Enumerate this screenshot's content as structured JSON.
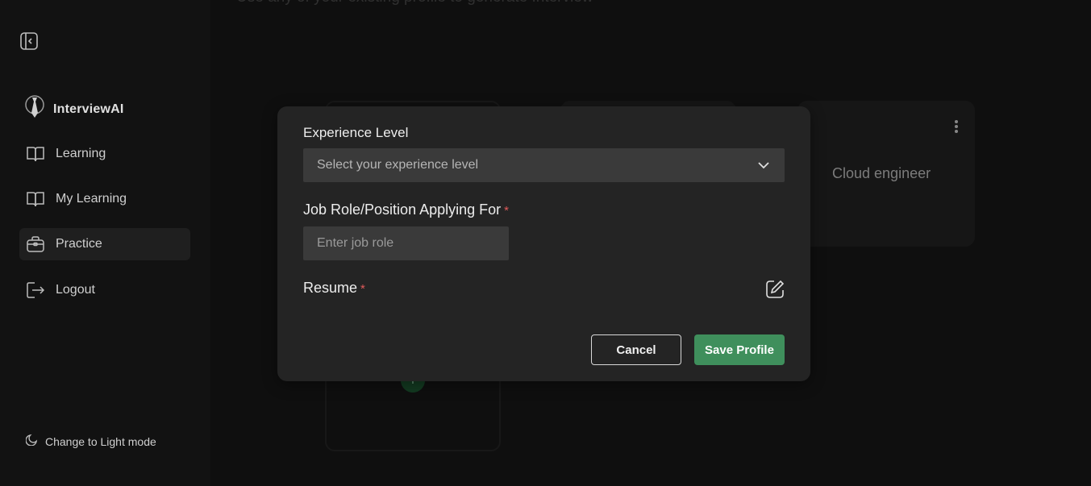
{
  "sidebar": {
    "brand": "InterviewAI",
    "items": [
      {
        "label": "Learning",
        "icon": "book-icon"
      },
      {
        "label": "My Learning",
        "icon": "book-icon"
      },
      {
        "label": "Practice",
        "icon": "briefcase-icon",
        "active": true
      },
      {
        "label": "Logout",
        "icon": "logout-icon"
      }
    ],
    "theme_toggle": "Change to Light mode"
  },
  "main": {
    "subtitle": "Use any of your existing profile to generate Interview",
    "profile_card_title": "Cloud engineer",
    "add_button": "+"
  },
  "modal": {
    "experience_label": "Experience Level",
    "experience_value": "Select your experience level",
    "job_role_label": "Job Role/Position Applying For",
    "job_role_placeholder": "Enter job role",
    "resume_label": "Resume",
    "required_mark": "*",
    "cancel_label": "Cancel",
    "save_label": "Save Profile"
  },
  "colors": {
    "accent": "#3f8f5c",
    "required": "#e05a5a",
    "background": "#171717",
    "sidebar": "#121212",
    "modal": "#242424"
  }
}
